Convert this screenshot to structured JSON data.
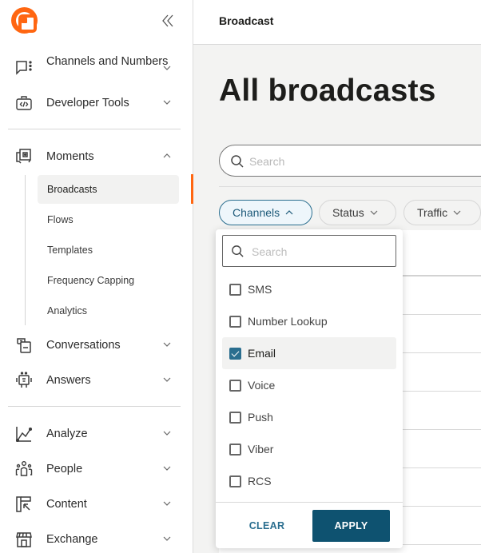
{
  "sidebar": {
    "logo": "infobip-logo",
    "collapse_icon": "double-chevron-left-icon",
    "items": [
      {
        "label": "Channels and Numbers",
        "icon": "chat-dots-icon",
        "expanded": false
      },
      {
        "label": "Developer Tools",
        "icon": "code-briefcase-icon",
        "expanded": false
      },
      {
        "label": "Moments",
        "icon": "moments-icon",
        "expanded": true
      },
      {
        "label": "Conversations",
        "icon": "conversations-icon",
        "expanded": false
      },
      {
        "label": "Answers",
        "icon": "bot-icon",
        "expanded": false
      },
      {
        "label": "Analyze",
        "icon": "line-chart-icon",
        "expanded": false
      },
      {
        "label": "People",
        "icon": "people-icon",
        "expanded": false
      },
      {
        "label": "Content",
        "icon": "content-icon",
        "expanded": false
      },
      {
        "label": "Exchange",
        "icon": "store-icon",
        "expanded": false
      }
    ],
    "moments_subitems": [
      {
        "label": "Broadcasts",
        "active": true
      },
      {
        "label": "Flows",
        "active": false
      },
      {
        "label": "Templates",
        "active": false
      },
      {
        "label": "Frequency Capping",
        "active": false
      },
      {
        "label": "Analytics",
        "active": false
      }
    ]
  },
  "header": {
    "breadcrumb": "Broadcast"
  },
  "main": {
    "title": "All broadcasts",
    "search_placeholder": "Search",
    "filters": [
      {
        "label": "Channels",
        "open": true
      },
      {
        "label": "Status",
        "open": false
      },
      {
        "label": "Traffic",
        "open": false
      }
    ]
  },
  "channels_dropdown": {
    "search_placeholder": "Search",
    "options": [
      {
        "label": "SMS",
        "checked": false
      },
      {
        "label": "Number Lookup",
        "checked": false
      },
      {
        "label": "Email",
        "checked": true
      },
      {
        "label": "Voice",
        "checked": false
      },
      {
        "label": "Push",
        "checked": false
      },
      {
        "label": "Viber",
        "checked": false
      },
      {
        "label": "RCS",
        "checked": false
      }
    ],
    "clear_label": "CLEAR",
    "apply_label": "APPLY"
  },
  "colors": {
    "brand": "#ff6611",
    "accent": "#0e5270",
    "checkbox": "#2a6e8f"
  }
}
